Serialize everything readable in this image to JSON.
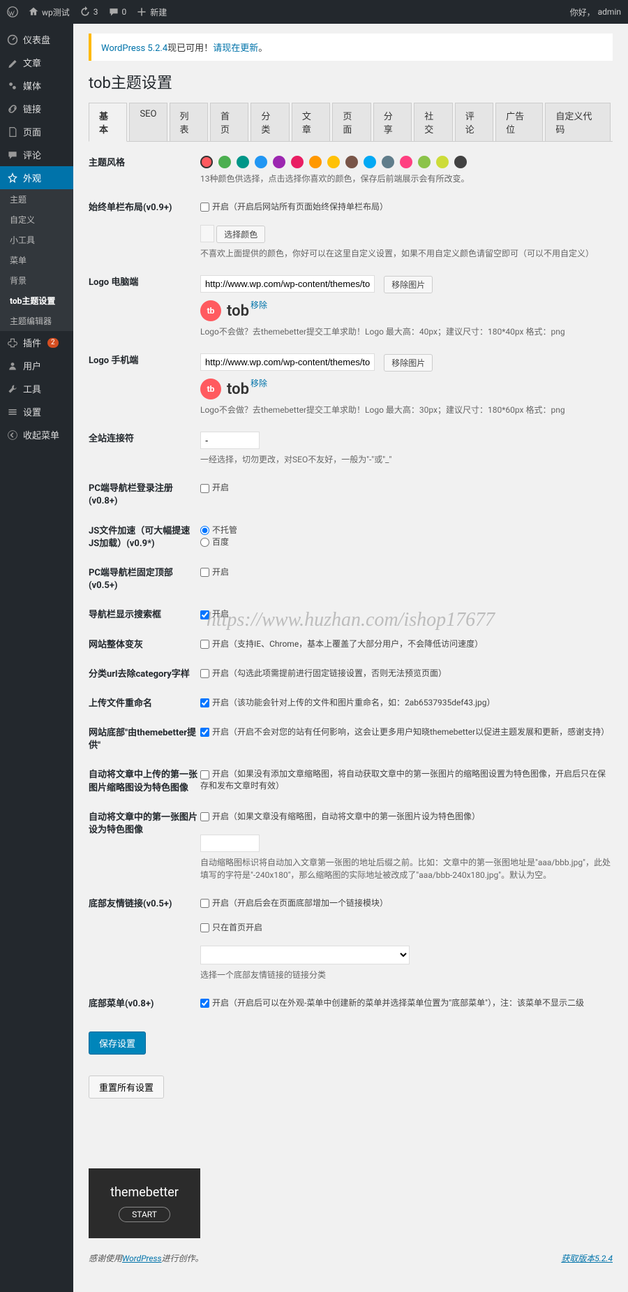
{
  "adminbar": {
    "site": "wp测试",
    "updates": "3",
    "comments": "0",
    "new": "新建",
    "user": "admin"
  },
  "sidebar": {
    "items": [
      {
        "label": "仪表盘"
      },
      {
        "label": "文章"
      },
      {
        "label": "媒体"
      },
      {
        "label": "链接"
      },
      {
        "label": "页面"
      },
      {
        "label": "评论"
      },
      {
        "label": "外观",
        "active": true
      },
      {
        "label": "插件",
        "badge": "2"
      },
      {
        "label": "用户"
      },
      {
        "label": "工具"
      },
      {
        "label": "设置"
      },
      {
        "label": "收起菜单"
      }
    ],
    "submenu": [
      {
        "label": "主题"
      },
      {
        "label": "自定义"
      },
      {
        "label": "小工具"
      },
      {
        "label": "菜单"
      },
      {
        "label": "背景"
      },
      {
        "label": "tob主题设置",
        "current": true
      },
      {
        "label": "主题编辑器"
      }
    ]
  },
  "update_nag": {
    "prefix": "WordPress 5.2.4",
    "mid": "现已可用！",
    "link": "请现在更新",
    "suffix": "。"
  },
  "page_title": "tob主题设置",
  "tabs": [
    "基本",
    "SEO",
    "列表",
    "首页",
    "分类",
    "文章",
    "页面",
    "分享",
    "社交",
    "评论",
    "广告位",
    "自定义代码"
  ],
  "colors": [
    "#ff5a5f",
    "#4caf50",
    "#009688",
    "#2196f3",
    "#9c27b0",
    "#e91e63",
    "#ff9800",
    "#ffc107",
    "#795548",
    "#03a9f4",
    "#607d8b",
    "#ff4081",
    "#8bc34a",
    "#cddc39",
    "#424242"
  ],
  "rows": {
    "theme_style": {
      "label": "主题风格",
      "desc": "13种颜色供选择，点击选择你喜欢的颜色，保存后前端展示会有所改变。"
    },
    "single_col": {
      "label": "始终单栏布局(v0.9+)",
      "chk": "开启（开启后网站所有页面始终保持单栏布局）"
    },
    "pick_color": {
      "btn": "选择颜色",
      "desc": "不喜欢上面提供的颜色，你好可以在这里自定义设置，如果不用自定义颜色请留空即可（可以不用自定义）"
    },
    "logo_pc": {
      "label": "Logo 电脑端",
      "url": "http://www.wp.com/wp-content/themes/tob/img/logo.png",
      "btn": "移除图片",
      "remove": "移除",
      "logo_text": "tob",
      "desc": "Logo不会做？去themebetter提交工单求助！Logo 最大高：40px；建议尺寸：180*40px 格式：png"
    },
    "logo_mobile": {
      "label": "Logo 手机端",
      "url": "http://www.wp.com/wp-content/themes/tob/img/logo.png",
      "btn": "移除图片",
      "remove": "移除",
      "logo_text": "tob",
      "desc": "Logo不会做？去themebetter提交工单求助！Logo 最大高：30px；建议尺寸：180*60px 格式：png"
    },
    "connector": {
      "label": "全站连接符",
      "value": "-",
      "desc": "一经选择，切勿更改，对SEO不友好，一般为\"-\"或\"_\""
    },
    "nav_login": {
      "label": "PC端导航栏登录注册(v0.8+)",
      "chk": "开启"
    },
    "js_accel": {
      "label": "JS文件加速（可大幅提速JS加载）(v0.9*)",
      "opt1": "不托管",
      "opt2": "百度"
    },
    "nav_fixed": {
      "label": "PC端导航栏固定顶部(v0.5+)",
      "chk": "开启"
    },
    "nav_search": {
      "label": "导航栏显示搜索框",
      "chk": "开启"
    },
    "site_gray": {
      "label": "网站整体变灰",
      "chk": "开启（支持IE、Chrome，基本上覆盖了大部分用户，不会降低访问速度）"
    },
    "url_remove_cat": {
      "label": "分类url去除category字样",
      "chk": "开启（勾选此项需提前进行固定链接设置，否则无法预览页面）"
    },
    "file_rename": {
      "label": "上传文件重命名",
      "chk": "开启（该功能会针对上传的文件和图片重命名，如：2ab6537935def43.jpg）"
    },
    "footer_credit": {
      "label": "网站底部\"由themebetter提供\"",
      "chk": "开启（开启不会对您的站有任何影响，这会让更多用户知晓themebetter以促进主题发展和更新，感谢支持）"
    },
    "auto_thumb": {
      "label": "自动将文章中上传的第一张图片缩略图设为特色图像",
      "chk": "开启（如果没有添加文章缩略图，将自动获取文章中的第一张图片的缩略图设置为特色图像，开启后只在保存和发布文章时有效）"
    },
    "auto_first": {
      "label": "自动将文章中的第一张图片设为特色图像",
      "chk": "开启（如果文章没有缩略图，自动将文章中的第一张图片设为特色图像）",
      "desc": "自动缩略图标识将自动加入文章第一张图的地址后缀之前。比如：文章中的第一张图地址是\"aaa/bbb.jpg\"，此处填写的字符是\"-240x180\"，那么缩略图的实际地址被改成了\"aaa/bbb-240x180.jpg\"。默认为空。"
    },
    "footer_links": {
      "label": "底部友情链接(v0.5+)",
      "chk1": "开启（开启后会在页面底部增加一个链接模块）",
      "chk2": "只在首页开启",
      "desc": "选择一个底部友情链接的链接分类"
    },
    "footer_menu": {
      "label": "底部菜单(v0.8+)",
      "chk": "开启（开启后可以在外观-菜单中创建新的菜单并选择菜单位置为\"底部菜单\"），注：该菜单不显示二级"
    }
  },
  "buttons": {
    "save": "保存设置",
    "reset": "重置所有设置"
  },
  "themebetter": {
    "title": "themebetter",
    "btn": "START"
  },
  "footer": {
    "thanks_prefix": "感谢使用",
    "wp": "WordPress",
    "thanks_suffix": "进行创作。",
    "version": "获取版本5.2.4"
  },
  "watermark": "https://www.huzhan.com/ishop17677"
}
